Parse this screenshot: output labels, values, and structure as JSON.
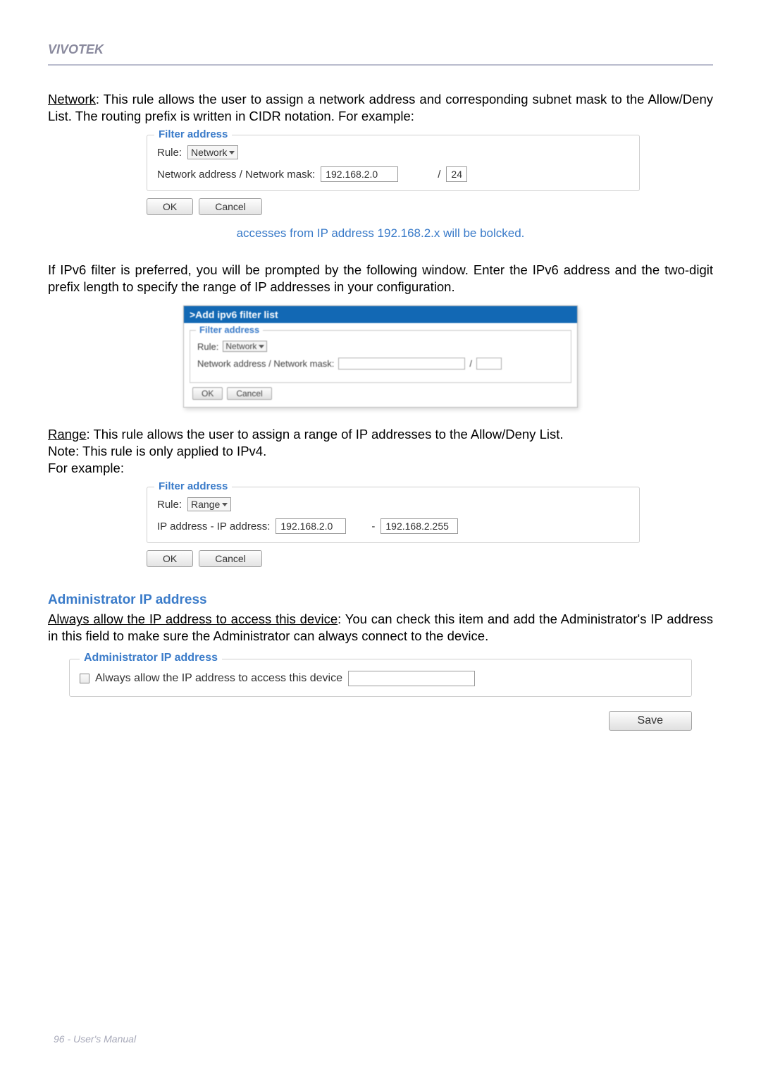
{
  "header": {
    "brand": "VIVOTEK"
  },
  "p1": {
    "lead": "Network",
    "rest": ": This rule allows the user to assign a network address and corresponding subnet mask to the Allow/Deny List. The routing prefix is written in CIDR notation. For example:"
  },
  "fig1": {
    "legend": "Filter address",
    "ruleLabel": "Rule:",
    "ruleValue": "Network",
    "addrLabel": "Network address / Network mask:",
    "addrValue": "192.168.2.0",
    "slash": "/",
    "maskValue": "24",
    "ok": "OK",
    "cancel": "Cancel"
  },
  "caption1": "accesses from IP address 192.168.2.x will be bolcked.",
  "p2": "If IPv6 filter is preferred, you will be prompted by the following window. Enter the IPv6 address and the two-digit prefix length to specify the range of IP addresses in your configuration.",
  "ipv6": {
    "title": ">Add ipv6 filter list",
    "legend": "Filter address",
    "ruleLabel": "Rule:",
    "ruleValue": "Network",
    "addrLabel": "Network address / Network mask:",
    "slash": "/",
    "ok": "OK",
    "cancel": "Cancel"
  },
  "p3": {
    "lead": "Range",
    "rest": ": This rule allows the user to assign a range of IP addresses to the Allow/Deny List.",
    "note": "Note: This rule is only applied to IPv4.",
    "example": "For example:"
  },
  "fig3": {
    "legend": "Filter address",
    "ruleLabel": "Rule:",
    "ruleValue": "Range",
    "addrLabel": "IP address - IP address:",
    "addr1": "192.168.2.0",
    "dash": "-",
    "addr2": "192.168.2.255",
    "ok": "OK",
    "cancel": "Cancel"
  },
  "admin": {
    "heading": "Administrator IP address",
    "lead": "Always allow the IP address to access this device",
    "rest": ": You can check this item and add the Administrator's IP address in this field to make sure the Administrator can always connect to the device.",
    "legend": "Administrator IP address",
    "checkboxLabel": "Always allow the IP address to access this device",
    "save": "Save"
  },
  "footer": "96 - User's Manual"
}
